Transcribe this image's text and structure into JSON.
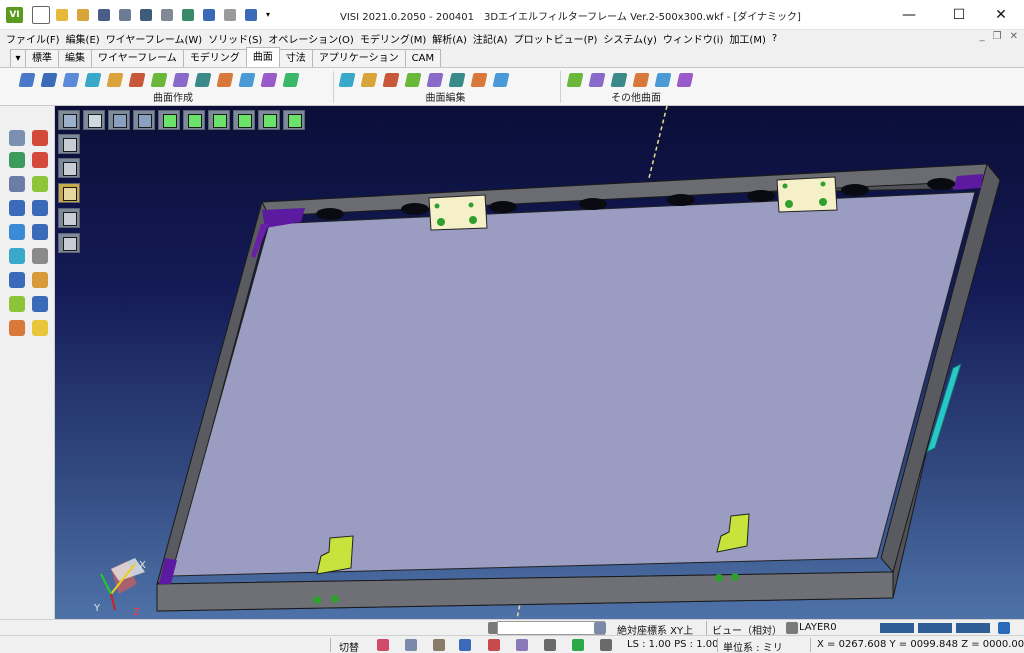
{
  "window": {
    "app_logo": "VI",
    "title": "VISI 2021.0.2050 - 200401　3Dエイエルフィルターフレーム Ver.2-500x300.wkf - [ダイナミック]",
    "minimize": "—",
    "maximize": "☐",
    "close": "✕"
  },
  "quick_access_icons": [
    "new-file-icon",
    "open-folder-icon",
    "open-recent-icon",
    "save-icon",
    "print-icon",
    "plot-icon",
    "printer-icon",
    "globe-icon",
    "undo-icon",
    "redo-icon",
    "settings-icon",
    "dropdown-arrow-icon"
  ],
  "menu": [
    "ファイル(F)",
    "編集(E)",
    "ワイヤーフレーム(W)",
    "ソリッド(S)",
    "オペレーション(O)",
    "モデリング(M)",
    "解析(A)",
    "注記(A)",
    "プロットビュー(P)",
    "システム(y)",
    "ウィンドウ(i)",
    "加工(M)",
    "?"
  ],
  "mdi_controls": {
    "minimize": "_",
    "restore": "❐",
    "close": "✕"
  },
  "ribbon": {
    "tabs": [
      "標準",
      "編集",
      "ワイヤーフレーム",
      "モデリング",
      "曲面",
      "寸法",
      "アプリケーション",
      "CAM"
    ],
    "active_tab": "曲面",
    "groups": [
      {
        "label": "曲面作成",
        "icon_count": 13
      },
      {
        "label": "曲面編集",
        "icon_count": 8
      },
      {
        "label": "その他曲面",
        "icon_count": 6
      }
    ]
  },
  "viewport": {
    "view_toolbar_icons": [
      "view-menu-icon",
      "view-fit-icon",
      "zoom-icon",
      "pan-icon",
      "front-view-icon",
      "top-view-icon",
      "side-view-icon",
      "iso-view-icon",
      "wire-view-icon",
      "shaded-view-icon"
    ],
    "render_toolbar_icons": [
      "wireframe-mode-icon",
      "hidden-line-icon",
      "shaded-mode-icon",
      "shaded-edges-icon",
      "transparent-mode-icon"
    ],
    "axis_labels": {
      "x": "X",
      "y": "Y",
      "z": "Z"
    },
    "colors": {
      "background_top": "#0a0e38",
      "background_bottom": "#4e72a8",
      "panel": "#9b9cc1",
      "frame": "#5c5d63",
      "clip": "#f5f0c8",
      "bracket": "#c8e43c",
      "accent": "#6a1fa8"
    }
  },
  "status_bar": {
    "coord_system": "絶対座標系 XY上",
    "view": "ビュー（相対）",
    "layer": "LAYER0",
    "toggle": "切替",
    "ls_ps": "LS : 1.00 PS : 1.00",
    "units": "単位系 : ミリ",
    "coordinates": "X = 0267.608 Y = 0099.848 Z = 0000.000"
  }
}
